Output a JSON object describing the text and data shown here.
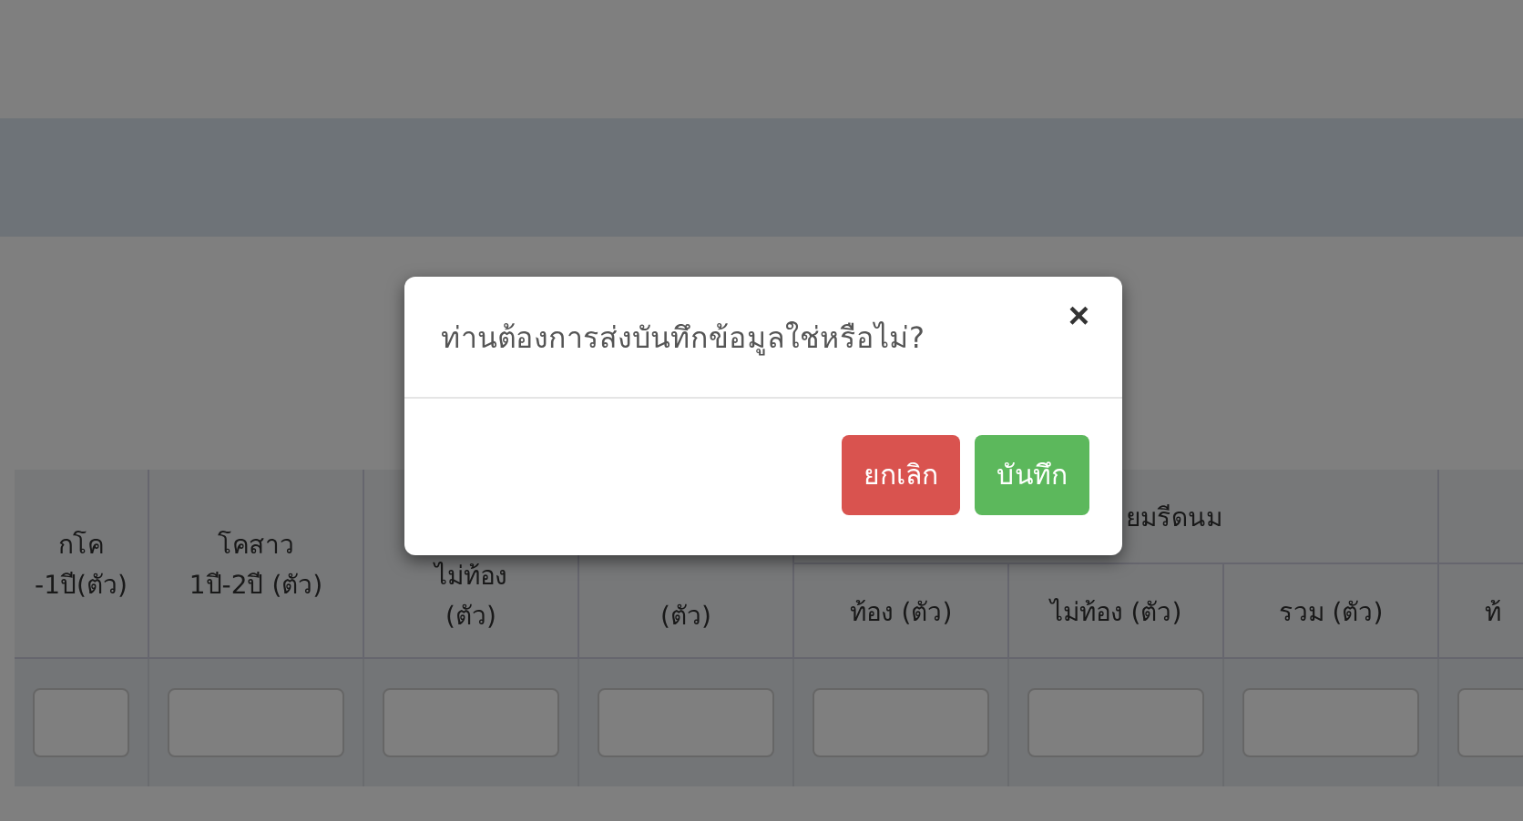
{
  "table": {
    "columns": [
      {
        "lines": [
          "กโค",
          "-1ปี(ตัว)"
        ]
      },
      {
        "lines": [
          "โคสาว",
          "1ปี-2ปี (ตัว)"
        ]
      },
      {
        "lines": [
          "ไม่ท้อง",
          "(ตัว)"
        ]
      },
      {
        "lines": [
          "(ตัว)"
        ]
      },
      {
        "group": "ยมรีดนม",
        "children": [
          {
            "lines": [
              "ท้อง (ตัว)"
            ]
          },
          {
            "lines": [
              "ไม่ท้อง (ตัว)"
            ]
          },
          {
            "lines": [
              "รวม (ตัว)"
            ]
          }
        ]
      },
      {
        "children": [
          {
            "lines": [
              "ท้"
            ]
          }
        ]
      }
    ]
  },
  "dialog": {
    "message": "ท่านต้องการส่งบันทึกข้อมูลใช่หรือไม่?",
    "close": "×",
    "buttons": [
      {
        "kind": "cancel",
        "label": "ยกเลิก"
      },
      {
        "kind": "confirm",
        "label": "บันทึก"
      }
    ]
  }
}
